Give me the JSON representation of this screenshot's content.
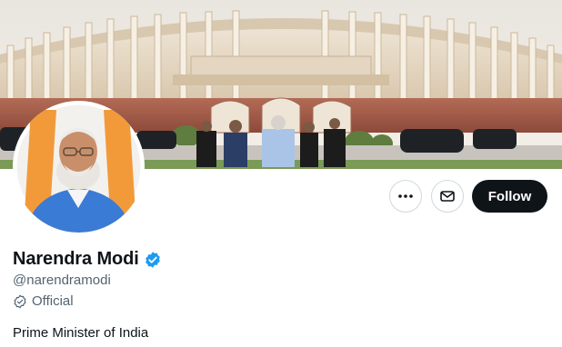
{
  "profile": {
    "display_name": "Narendra Modi",
    "handle": "@narendramodi",
    "label": "Official",
    "bio": "Prime Minister of India",
    "verified": true
  },
  "actions": {
    "follow_label": "Follow",
    "more_icon": "more-horizontal-icon",
    "message_icon": "envelope-icon"
  },
  "colors": {
    "verified_badge": "#1d9bf0",
    "follow_button_bg": "#0f1419",
    "follow_button_text": "#ffffff",
    "secondary_text": "#536471",
    "primary_text": "#0f1419"
  }
}
